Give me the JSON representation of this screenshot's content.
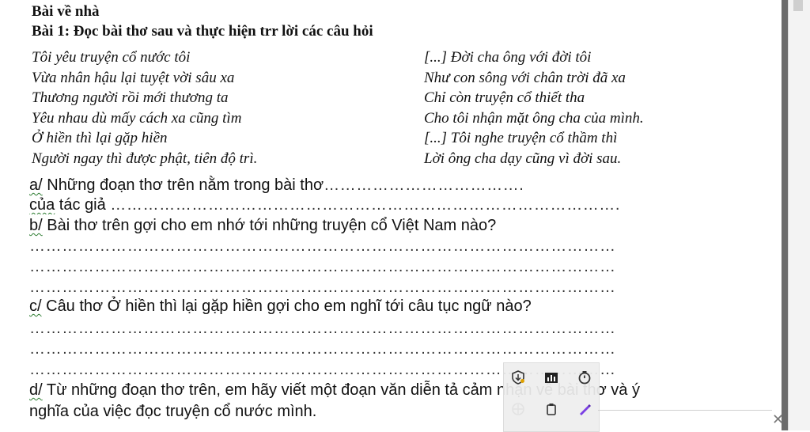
{
  "heading": "Bài về nhà",
  "exercise_title": "Bài 1:  Đọc bài thơ sau và thực hiện trr lời các câu hỏi",
  "poem": {
    "left": [
      "Tôi yêu truyện cổ nước tôi",
      "Vừa nhân hậu lại tuyệt vời sâu xa",
      "Thương người rồi mới thương ta",
      "Yêu nhau dù mấy cách xa cũng tìm",
      "Ở hiền thì lại gặp hiền",
      "Người ngay thì được phật, tiên độ trì."
    ],
    "right": [
      "[...] Đời cha ông với đời tôi",
      "Như con sông với chân trời đã xa",
      "Chỉ còn truyện cổ thiết tha",
      "Cho tôi nhận mặt ông cha của mình.",
      "[...] Tôi nghe truyện cổ thầm thì",
      "Lời ông cha dạy cũng vì đời sau."
    ]
  },
  "questions": {
    "a_line1_prefix": "a/",
    "a_line1_text": " Những đoạn thơ trên nằm trong bài thơ",
    "a_line1_dots": "……………………………….",
    "a_line2_prefix": "của",
    "a_line2_text": " tác giả ",
    "a_line2_dots": "………………………………………………………………………………….",
    "b_prefix": "b/",
    "b_text": " Bài thơ trên gợi cho em nhớ tới những truyện cổ Việt Nam nào?",
    "c_prefix": "c/",
    "c_text": " Câu thơ Ở hiền thì lại gặp hiền gợi cho em nghĩ tới câu tục ngữ nào?",
    "d_prefix": "d/",
    "d_text_line1": " Từ những đoạn thơ trên, em hãy viết một đoạn văn diễn tả cảm nhận về bài thơ và ý",
    "d_text_line2": "nghĩa của việc đọc truyện cổ nước mình.",
    "dotted_line": "………………………………………………………………………………………………"
  },
  "toolbar_icons": [
    "shield-download-icon",
    "chart-bar-icon",
    "timer-icon",
    "move-icon",
    "clipboard-icon",
    "pen-icon"
  ],
  "accent_color": "#7b3fe4"
}
